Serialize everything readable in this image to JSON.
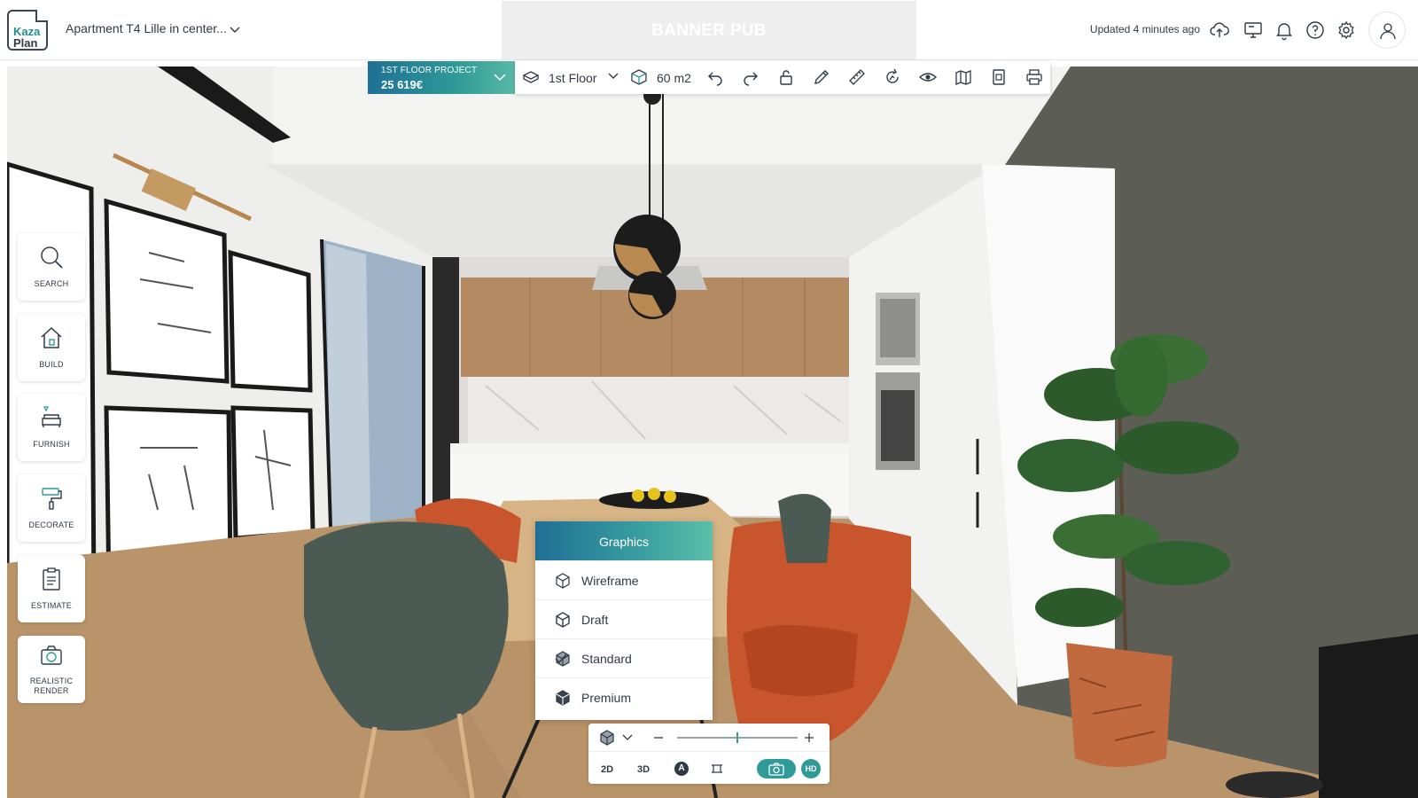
{
  "header": {
    "logo_line1": "Kaza",
    "logo_line2": "Plan",
    "project_title": "Apartment T4 Lille in center...",
    "banner_text": "BANNER PUB",
    "updated_text": "Updated 4 minutes ago",
    "icons": [
      "cloud-upload-icon",
      "monitor-icon",
      "bell-icon",
      "help-icon",
      "gear-icon",
      "user-icon"
    ]
  },
  "toolbar": {
    "project_label": "1ST FLOOR PROJECT",
    "project_price": "25 619€",
    "floor_label": "1st Floor",
    "area_label": "60 m2",
    "icons": [
      "floor-icon",
      "area-icon",
      "undo-icon",
      "redo-icon",
      "lock-icon",
      "pencil-icon",
      "ruler-icon",
      "rotate-icon",
      "eye-icon",
      "map-icon",
      "document-icon",
      "print-icon"
    ]
  },
  "sidebar": {
    "items": [
      {
        "label": "SEARCH",
        "icon": "search-icon"
      },
      {
        "label": "BUILD",
        "icon": "house-icon"
      },
      {
        "label": "FURNISH",
        "icon": "sofa-icon"
      },
      {
        "label": "DECORATE",
        "icon": "paint-roller-icon"
      },
      {
        "label": "ESTIMATE",
        "icon": "clipboard-icon"
      },
      {
        "label_line1": "REALISTIC",
        "label_line2": "RENDER",
        "icon": "camera-icon"
      }
    ]
  },
  "graphics_menu": {
    "title": "Graphics",
    "options": [
      {
        "label": "Wireframe",
        "selected": false
      },
      {
        "label": "Draft",
        "selected": false
      },
      {
        "label": "Standard",
        "selected": true
      },
      {
        "label": "Premium",
        "selected": false
      }
    ]
  },
  "view_control": {
    "mode_2d": "2D",
    "mode_3d": "3D",
    "auto_label": "A",
    "hd_label": "HD",
    "zoom_level": 0.5
  },
  "colors": {
    "accent": "#2f9a97",
    "gradient_start": "#1f6f95",
    "gradient_end": "#58b9a5",
    "text": "#2f3a46"
  }
}
